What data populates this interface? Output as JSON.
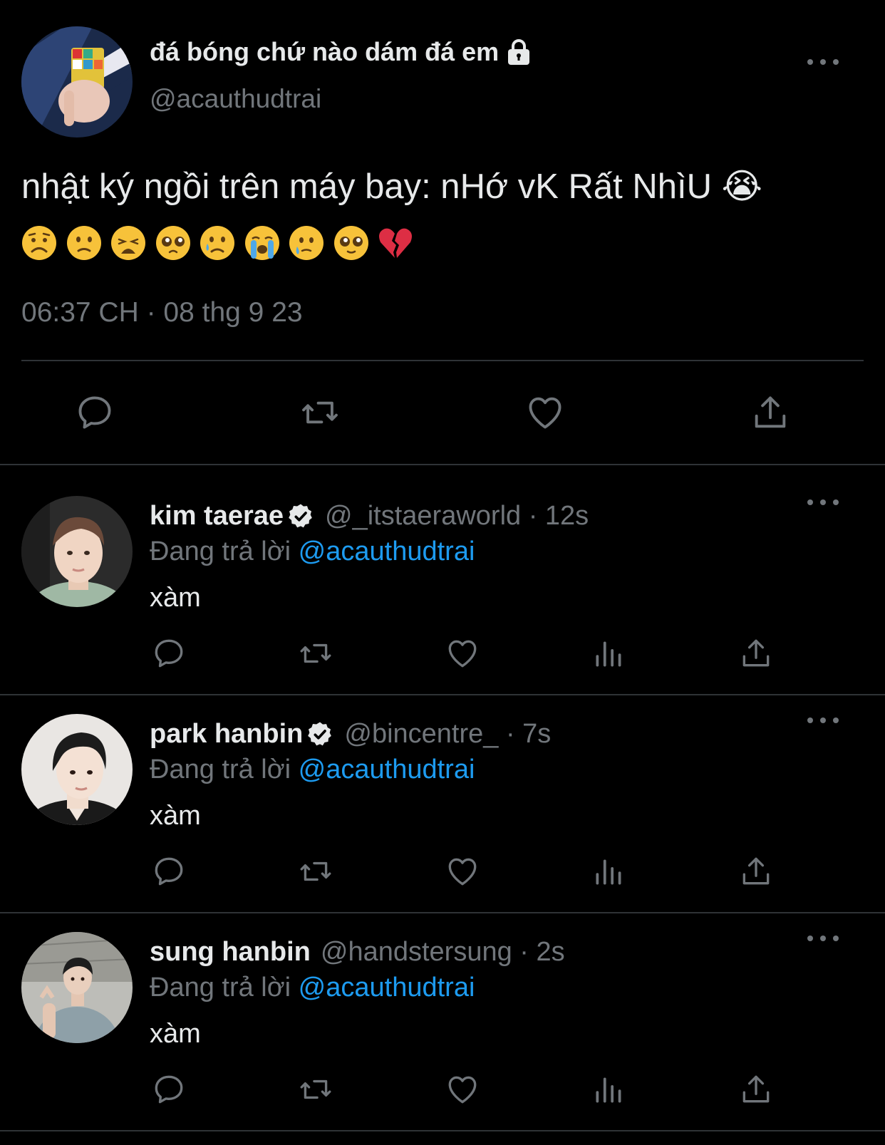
{
  "main_tweet": {
    "author_name": "đá bóng chứ nào dám đá em",
    "author_handle": "@acauthudtrai",
    "text": "nhật ký ngồi trên máy bay: nHớ vK Rất NhìU 😭",
    "emojis": [
      "frowning-face",
      "slightly-frowning-face",
      "weary-face",
      "pleading-face",
      "crying-face",
      "loudly-crying-face",
      "face-holding-back-tears",
      "pleading-face",
      "broken-heart"
    ],
    "timestamp": "06:37 CH · 08 thg 9 23",
    "protected": true
  },
  "replies": [
    {
      "name": "kim taerae",
      "verified": true,
      "handle_time": "@_itstaeraworld · 12s",
      "replying_prefix": "Đang trả lời ",
      "replying_to": "@acauthudtrai",
      "text": "xàm"
    },
    {
      "name": "park hanbin",
      "verified": true,
      "handle_time": "@bincentre_ · 7s",
      "replying_prefix": "Đang trả lời ",
      "replying_to": "@acauthudtrai",
      "text": "xàm"
    },
    {
      "name": "sung hanbin",
      "verified": false,
      "handle_time": "@handstersung · 2s",
      "replying_prefix": "Đang trả lời ",
      "replying_to": "@acauthudtrai",
      "text": "xàm"
    }
  ],
  "colors": {
    "background": "#000000",
    "text_primary": "#e7e9ea",
    "text_secondary": "#71767b",
    "link": "#1d9bf0",
    "divider": "#2f3336"
  }
}
